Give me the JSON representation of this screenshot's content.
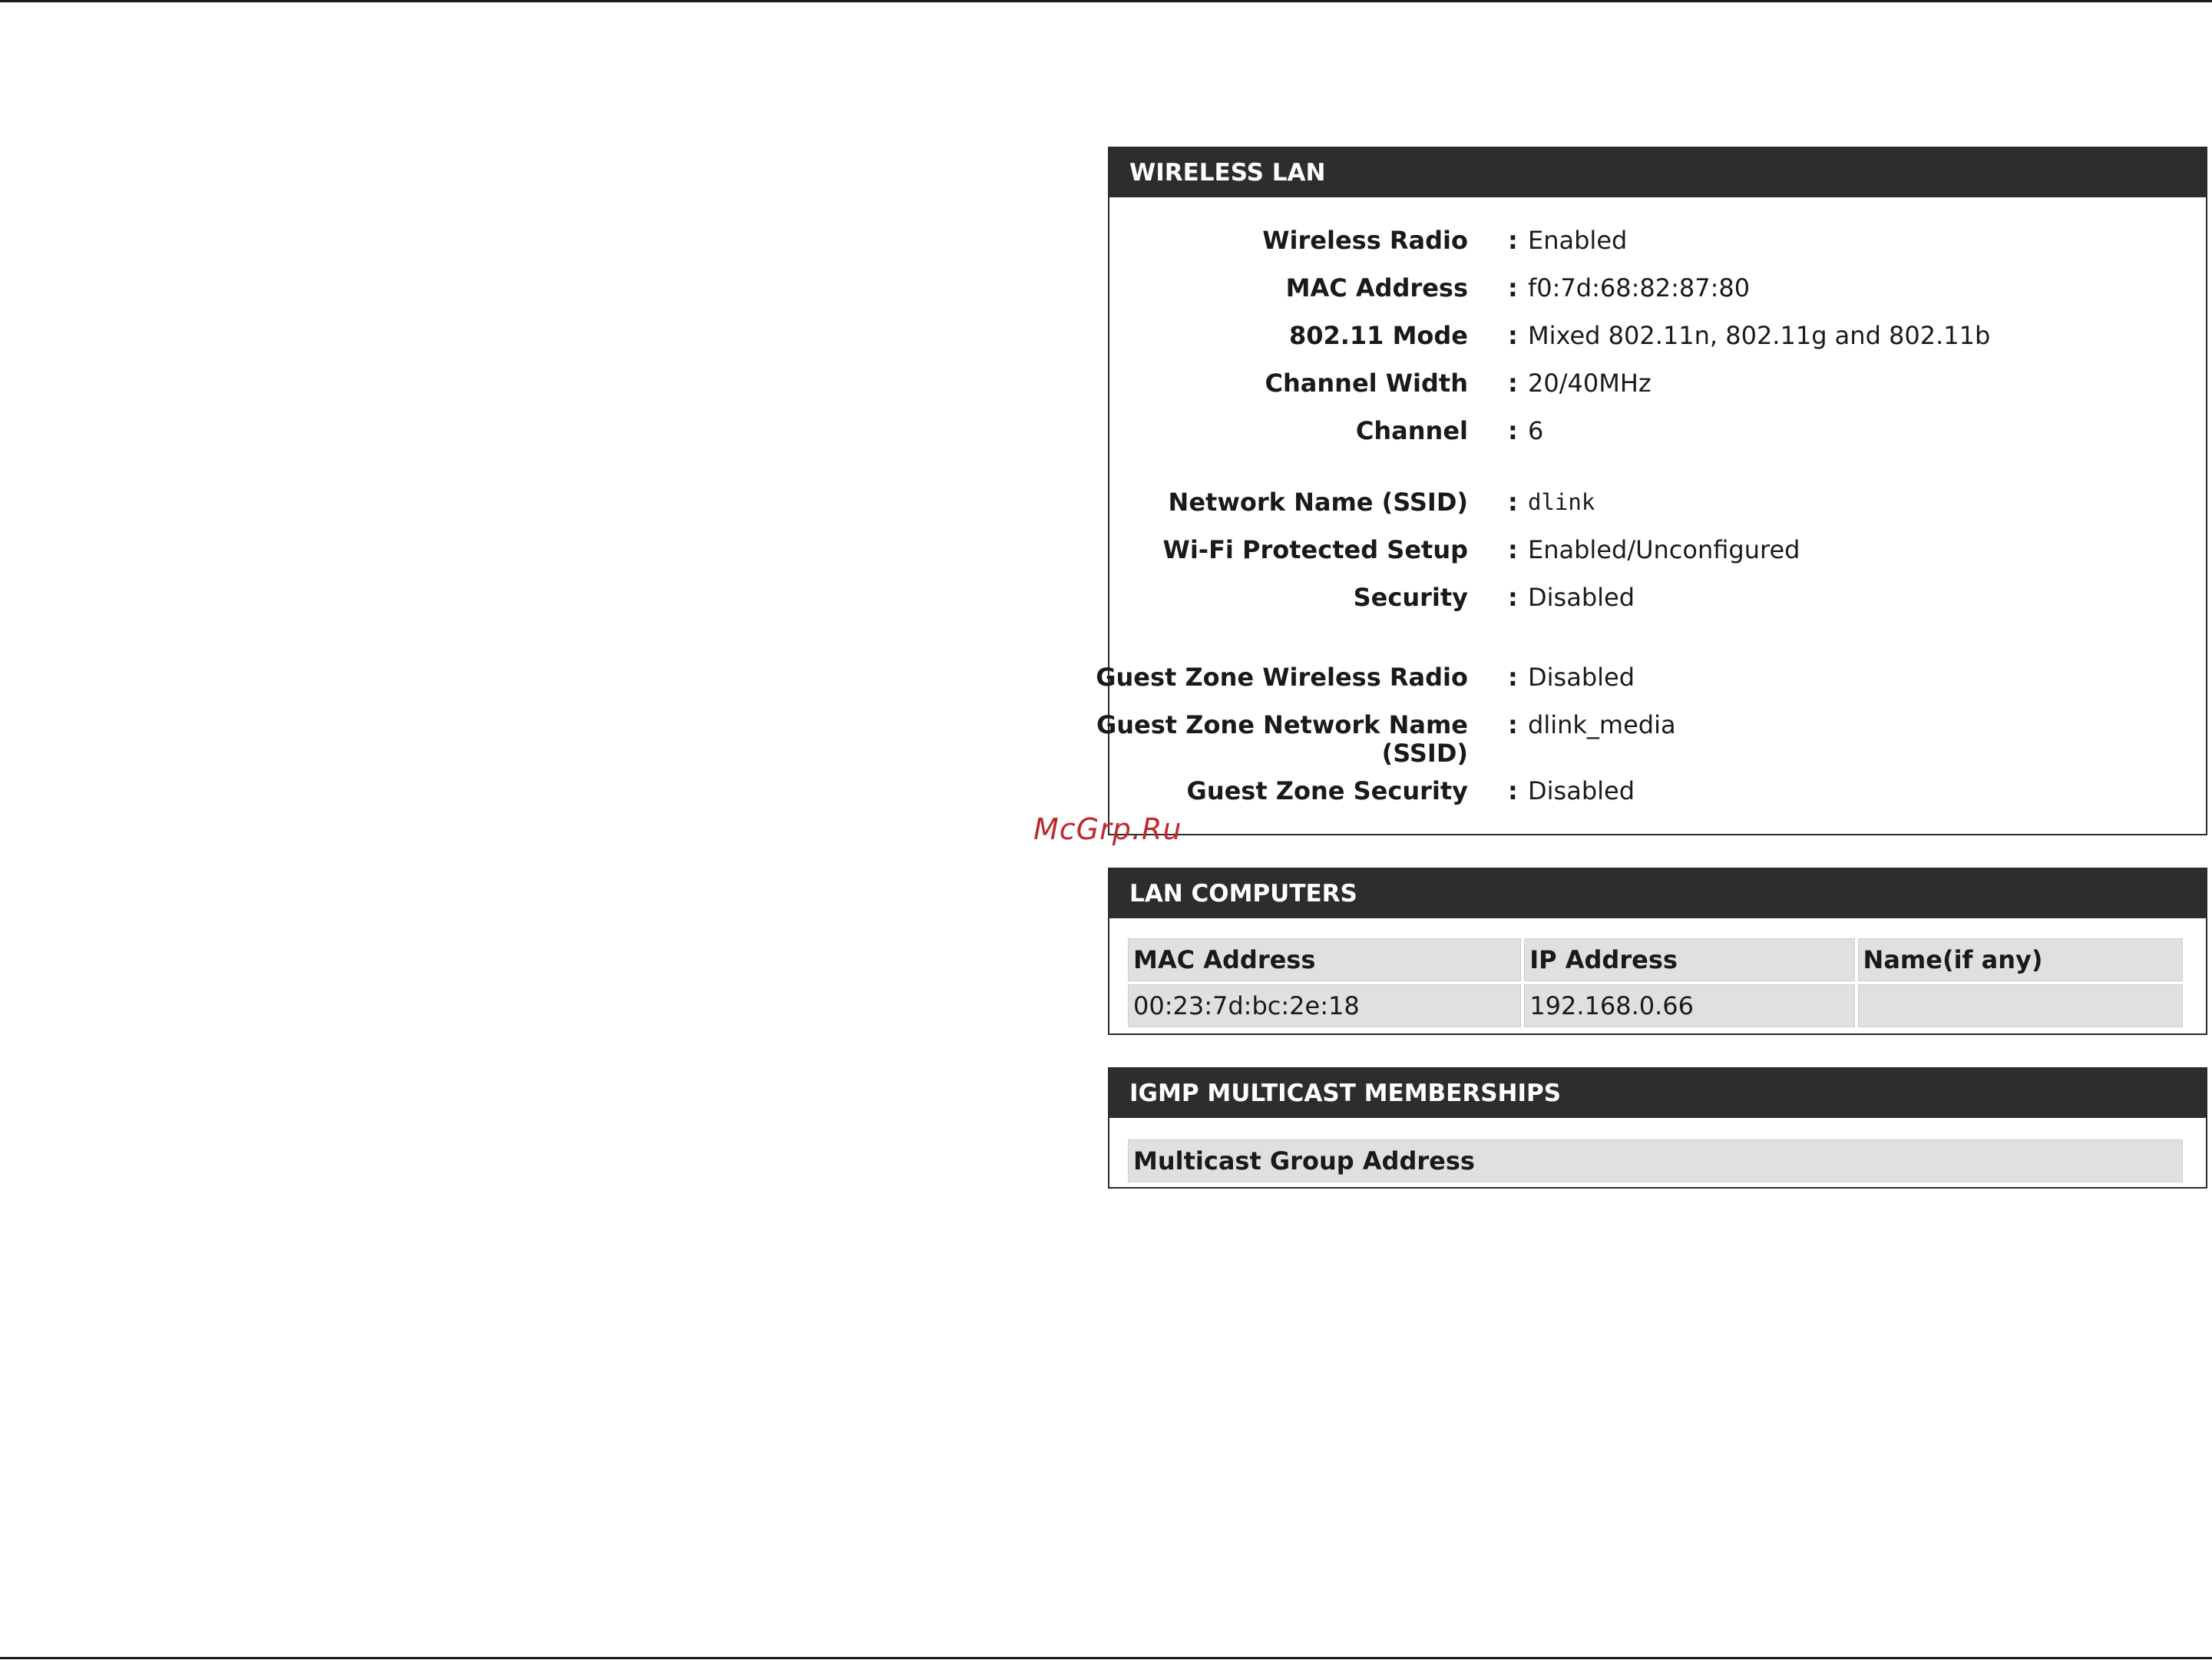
{
  "wireless_lan": {
    "title": "WIRELESS LAN",
    "rows": [
      {
        "label": "Wireless Radio",
        "value": "Enabled"
      },
      {
        "label": "MAC Address",
        "value": "f0:7d:68:82:87:80"
      },
      {
        "label": "802.11 Mode",
        "value": "Mixed 802.11n, 802.11g and 802.11b"
      },
      {
        "label": "Channel Width",
        "value": "20/40MHz"
      },
      {
        "label": "Channel",
        "value": "6"
      },
      {
        "label": "Network Name (SSID)",
        "value": "dlink"
      },
      {
        "label": "Wi-Fi Protected Setup",
        "value": "Enabled/Unconfigured"
      },
      {
        "label": "Security",
        "value": "Disabled"
      },
      {
        "label": "Guest Zone Wireless Radio",
        "value": "Disabled"
      },
      {
        "label": "Guest Zone Network Name",
        "label_line2": "(SSID)",
        "value": "dlink_media"
      },
      {
        "label": "Guest Zone Security",
        "value": "Disabled"
      }
    ],
    "separator": ":"
  },
  "lan_computers": {
    "title": "LAN COMPUTERS",
    "columns": [
      "MAC Address",
      "IP Address",
      "Name(if any)"
    ],
    "rows": [
      [
        "00:23:7d:bc:2e:18",
        "192.168.0.66",
        ""
      ]
    ]
  },
  "igmp": {
    "title": "IGMP MULTICAST MEMBERSHIPS",
    "columns": [
      "Multicast Group Address"
    ]
  },
  "watermark": "McGrp.Ru"
}
